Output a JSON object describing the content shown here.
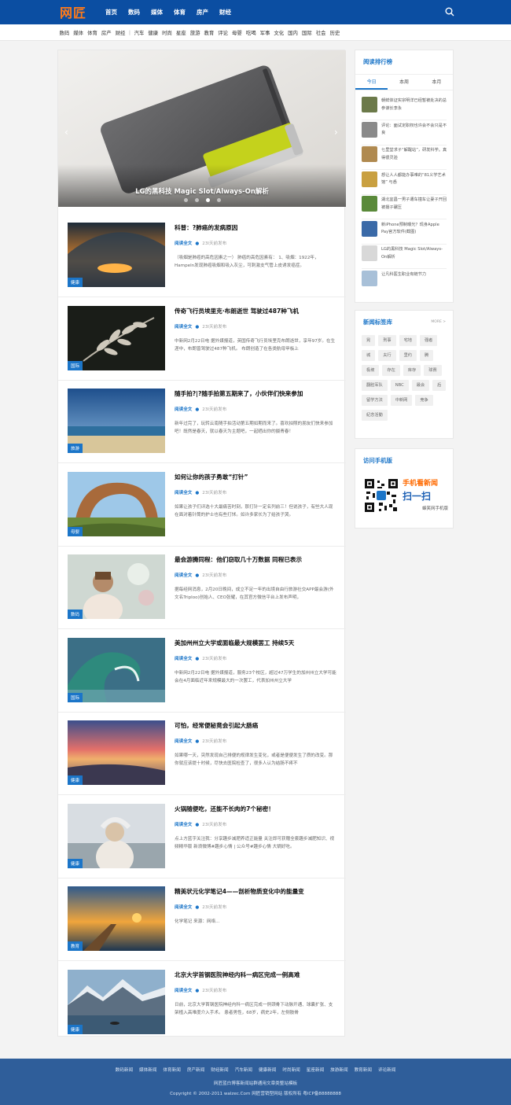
{
  "brand": {
    "logo": "网匠"
  },
  "topnav": [
    "首页",
    "数码",
    "媒体",
    "体育",
    "房产",
    "财经"
  ],
  "subnav": {
    "group1": [
      "数码",
      "媒体",
      "体育",
      "房产",
      "财经"
    ],
    "group2": [
      "汽车",
      "健康",
      "时尚",
      "星座",
      "旅游",
      "教育",
      "评论",
      "母婴",
      "吃喝",
      "军事",
      "文化",
      "国内",
      "国际",
      "社会",
      "历史"
    ]
  },
  "slider": {
    "caption": "LG的黑科技 Magic Slot/Always-On解析",
    "dots": 4,
    "active_dot": 3
  },
  "articles": [
    {
      "title": "科普：?肺癌的发病原因",
      "read": "阅读全文",
      "time": "23l天前发布",
      "excerpt": "（吸烟是肺癌的高危因素之一） 肺癌的高危因素有： 1、吸烟：1922年，Hampeln发现肺癌吸烟和吸入灰尘，可刺激支气管上皮诱发癌症。",
      "tag": "健康"
    },
    {
      "title": "传奇飞行员埃里克·布朗逝世 驾驶过487种飞机",
      "read": "阅读全文",
      "time": "23l天前发布",
      "excerpt": "中新网2月22日电 据外媒报道，英国传奇飞行员埃里克布朗逝世，享年97岁。在生涯中，布朗曾驾驶过487种飞机。 布朗创造了在各类航母甲板上",
      "tag": "国际"
    },
    {
      "title": "随手拍?|?随手拍第五期来了，小伙伴们快来参加",
      "read": "阅读全文",
      "time": "23l天前发布",
      "excerpt": "新年过完了，玩转云南随手拍活动第五期如期而来了。喜欢拍照的朋友们快来参加吧！既然是春天，就以春天为主题吧，一起晒出你的摄青春！",
      "tag": "旅游"
    },
    {
      "title": "如何让你的孩子勇敢“打针”",
      "read": "阅读全文",
      "time": "23l天前发布",
      "excerpt": "如果让孩子们评选十大最痛苦时刻，那打针一定名列前三！但说孩子，有些大人现在面对着针筒的护士也有些打怵。如许多家长为了给孩子哭。",
      "tag": "母婴"
    },
    {
      "title": "最会游腾同程：他们窃取几十万数据 同程已表示",
      "read": "阅读全文",
      "time": "23l天前发布",
      "excerpt": "据每经网消息，2月20日晚间，成立不足一年的出境自由行旅游社交APP最会游(外文名Triploo)创始人、CEO张耀，在其官方微信平台上发布声明，",
      "tag": "数码"
    },
    {
      "title": "美加州州立大学或面临最大规模罢工 持续5天",
      "read": "阅读全文",
      "time": "23l天前发布",
      "excerpt": "中新网2月22日电 据外媒报道，服务23个校区，超过47万学生的加州州立大学可能会在4月面临近年来规模最大的一次罢工，代表加州州立大学",
      "tag": "国际"
    },
    {
      "title": "可怕，经常便秘竟会引起大肠癌",
      "read": "阅读全文",
      "time": "23l天前发布",
      "excerpt": "如果哪一天，突然发现自己排便的规律发生变化，或者是便便发生了质的改变。那你就应该提十时候，尽快去医院检查了，很多人认为结肠不疼不",
      "tag": "健康"
    },
    {
      "title": "火锅随便吃，还能不长肉的7个秘密！",
      "read": "阅读全文",
      "time": "23l天前发布",
      "excerpt": "点上方蓝字关注我：分享趣步减肥养适正能量 关注即可获赠全套趣步减肥知识、视频精华版 新浪微博#趣步心情 | 公众号#趣步心情 大锅好吃。",
      "tag": "健康"
    },
    {
      "title": "精美状元化学笔记4——剖析物质变化中的能量变",
      "read": "阅读全文",
      "time": "23l天前发布",
      "excerpt": "化学笔记 来源：网络...",
      "tag": "教育"
    },
    {
      "title": "北京大学首钢医院神经内科一病区完成一例高难",
      "read": "阅读全文",
      "time": "23l天前发布",
      "excerpt": "日前，北京大学首钢医院神经内科一病区完成一例颈骨下动脉开通、球囊扩张、支架植入高难度介入手术。 患者男性，68岁，病史2年，左侧肢骨",
      "tag": "健康"
    }
  ],
  "ranking": {
    "title": "阅读排行榜",
    "tabs": [
      "今日",
      "本周",
      "本月"
    ],
    "active_tab": 0,
    "items": [
      "朝鲜体证实宗明洋已经暂被处决的总参谋长李永",
      "评论：面试定职权也许会不会只是不良",
      "七里堂求子“解醒站”，研发科学。真得很灵验",
      "想让人人都能办事难的“81义学艺术馆” 与悉",
      "湖北宜昌一男子遭车撞车让妻子开回被摄子碾压",
      "新iPhone预制曝光？现身Apple Pay官方软件(截图)",
      "LG的黑科技 Magic Slot/Always-On解析",
      "让凡科医生职业有链节力"
    ]
  },
  "tags_box": {
    "title": "新闻标签库",
    "more": "MORE >",
    "tags": [
      "晃",
      "刑事",
      "宅地",
      "强者",
      "城",
      "夫行",
      "里约",
      "腾",
      "极坡",
      "存在",
      "库存",
      "球赛",
      "翻脸军队",
      "NBC",
      "最会",
      "后",
      "留学方法",
      "中新网",
      "竞争",
      "紀念活動"
    ]
  },
  "mobile_box": {
    "title": "访问手机版",
    "line1": "手机看新闻",
    "line2": "扫一扫",
    "line3": "蜂笑网手机版"
  },
  "footer": {
    "links": [
      "数码新闻",
      "媒体新闻",
      "体育新闻",
      "房产新闻",
      "财经新闻",
      "汽车新闻",
      "健康新闻",
      "时尚新闻",
      "星座新闻",
      "旅游新闻",
      "教育新闻",
      "评论新闻"
    ],
    "line2": "网匠蓝白博客新闻站群通用文章类整站模板",
    "line3": "Copyright © 2002-2011 walzec.Com 网匠营销型网站 版权所有 粤ICP备88888888"
  }
}
